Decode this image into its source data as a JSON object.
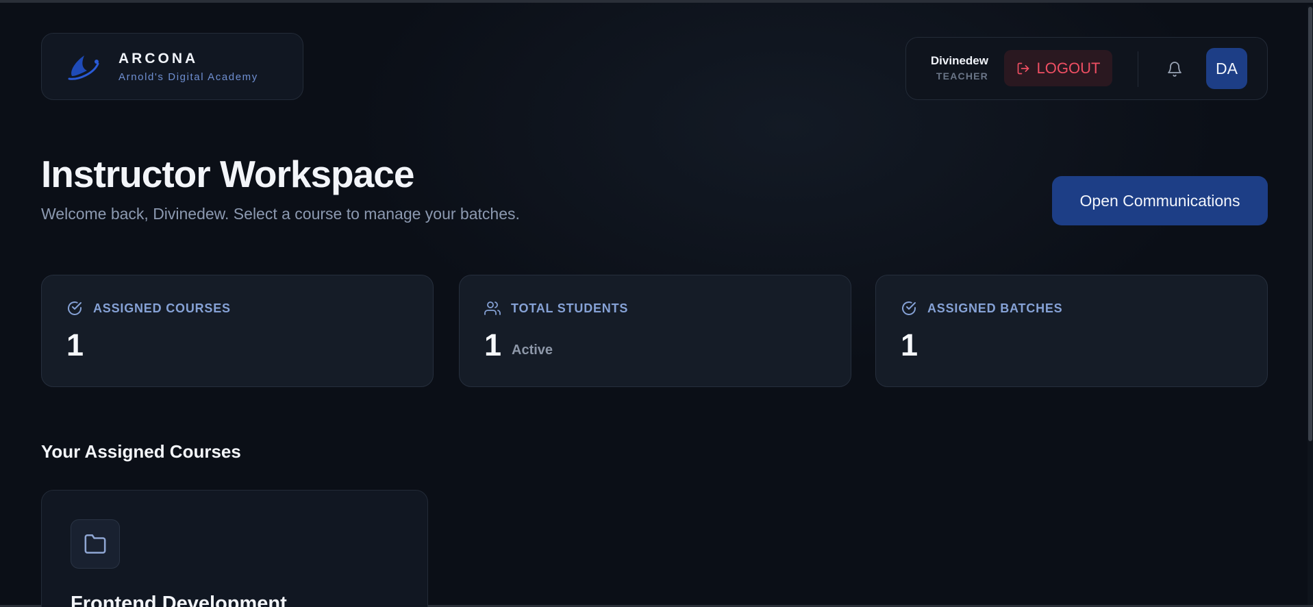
{
  "brand": {
    "name": "ARCONA",
    "tagline": "Arnold's Digital Academy"
  },
  "user": {
    "name": "Divinedew",
    "role": "TEACHER",
    "logout_label": "LOGOUT",
    "avatar_initials": "DA"
  },
  "header": {
    "title": "Instructor Workspace",
    "subtitle": "Welcome back, Divinedew. Select a course to manage your batches.",
    "communications_label": "Open Communications"
  },
  "stats": [
    {
      "label": "ASSIGNED COURSES",
      "value": "1",
      "note": "",
      "icon": "check-circle-icon"
    },
    {
      "label": "TOTAL STUDENTS",
      "value": "1",
      "note": "Active",
      "icon": "users-icon"
    },
    {
      "label": "ASSIGNED BATCHES",
      "value": "1",
      "note": "",
      "icon": "check-circle-icon"
    }
  ],
  "courses_section": {
    "title": "Your Assigned Courses",
    "courses": [
      {
        "title": "Frontend Development",
        "icon": "folder-icon"
      }
    ]
  },
  "colors": {
    "background": "#0b0f17",
    "card": "#151c27",
    "accent": "#1d3e86",
    "logout": "#ef4f63",
    "label": "#86a2d6"
  }
}
